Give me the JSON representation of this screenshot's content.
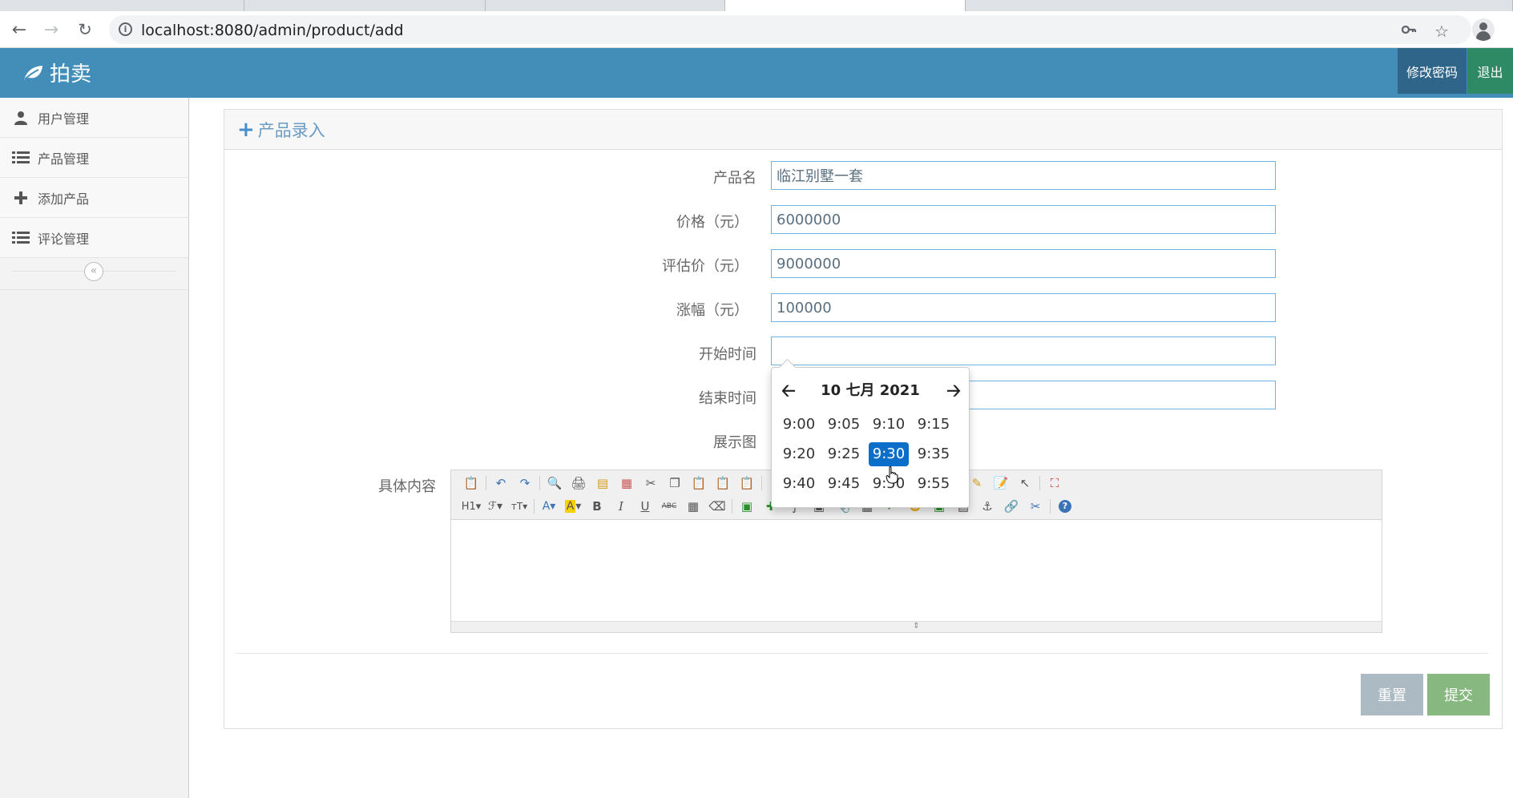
{
  "browser": {
    "url": "localhost:8080/admin/product/add"
  },
  "header": {
    "brand": "拍卖",
    "change_password": "修改密码",
    "logout": "退出"
  },
  "sidebar": {
    "items": [
      {
        "label": "用户管理",
        "icon": "user-icon"
      },
      {
        "label": "产品管理",
        "icon": "list-icon"
      },
      {
        "label": "添加产品",
        "icon": "plus-icon"
      },
      {
        "label": "评论管理",
        "icon": "list-icon"
      }
    ],
    "collapse_glyph": "«"
  },
  "panel": {
    "title": "产品录入"
  },
  "form": {
    "name_label": "产品名",
    "name_value": "临江别墅一套",
    "price_label": "价格（元）",
    "price_value": "6000000",
    "estimate_label": "评估价（元）",
    "estimate_value": "9000000",
    "increment_label": "涨幅（元）",
    "increment_value": "100000",
    "start_label": "开始时间",
    "start_value": "",
    "end_label": "结束时间",
    "end_value": "",
    "image_label": "展示图",
    "content_label": "具体内容"
  },
  "picker": {
    "title": "10 七月 2021",
    "times": [
      "9:00",
      "9:05",
      "9:10",
      "9:15",
      "9:20",
      "9:25",
      "9:30",
      "9:35",
      "9:40",
      "9:45",
      "9:50",
      "9:55"
    ],
    "selected": "9:30"
  },
  "buttons": {
    "reset": "重置",
    "submit": "提交"
  },
  "colors": {
    "header_bg": "#438eb9",
    "picker_selected": "#0b6ec9",
    "submit_bg": "#87b87f",
    "reset_bg": "#abbac3"
  }
}
